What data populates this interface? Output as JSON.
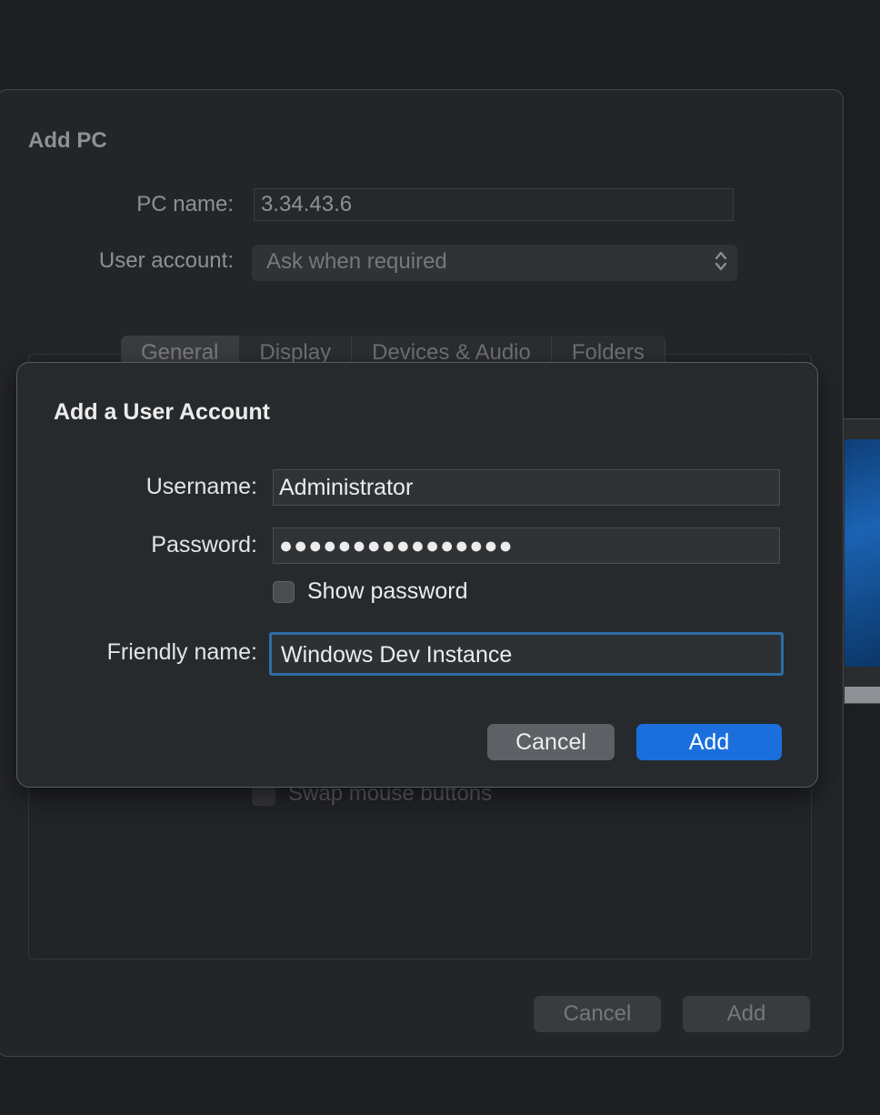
{
  "add_pc": {
    "title": "Add PC",
    "pc_name_label": "PC name:",
    "pc_name_value": "3.34.43.6",
    "user_account_label": "User account:",
    "user_account_value": "Ask when required",
    "tabs": [
      {
        "label": "General"
      },
      {
        "label": "Display"
      },
      {
        "label": "Devices & Audio"
      },
      {
        "label": "Folders"
      }
    ],
    "swap_mouse_label": "Swap mouse buttons",
    "cancel_label": "Cancel",
    "add_label": "Add"
  },
  "dialog": {
    "title": "Add a User Account",
    "username_label": "Username:",
    "username_value": "Administrator",
    "password_label": "Password:",
    "password_value": "●●●●●●●●●●●●●●●●",
    "show_password_label": "Show password",
    "friendly_name_label": "Friendly name:",
    "friendly_name_value": "Windows Dev Instance",
    "cancel_label": "Cancel",
    "add_label": "Add"
  },
  "colors": {
    "accent": "#1b6fdd",
    "focus_ring": "#2f6ea6",
    "background": "#1d1e1f"
  },
  "icons": {
    "select_arrows": "chevron-up-down-icon"
  }
}
